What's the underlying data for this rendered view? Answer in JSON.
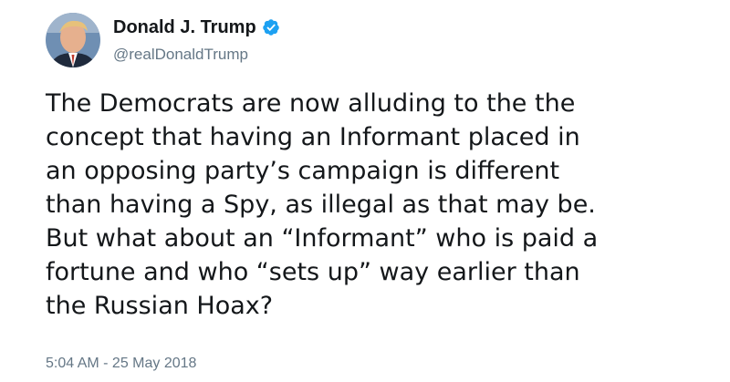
{
  "author": {
    "display_name": "Donald J. Trump",
    "handle": "@realDonaldTrump",
    "verified": true,
    "avatar_icon": "profile-photo"
  },
  "tweet": {
    "lines": [
      "The Democrats are now alluding to the the",
      "concept that having an Informant placed in",
      "an opposing party’s campaign is different",
      "than having a Spy, as illegal as that may be.",
      "But what about an “Informant” who is paid a",
      "fortune and who “sets up” way earlier than",
      "the Russian Hoax?"
    ],
    "timestamp": "5:04 AM - 25 May 2018"
  },
  "colors": {
    "text": "#14171a",
    "secondary": "#657786",
    "verified_badge": "#1da1f2"
  }
}
